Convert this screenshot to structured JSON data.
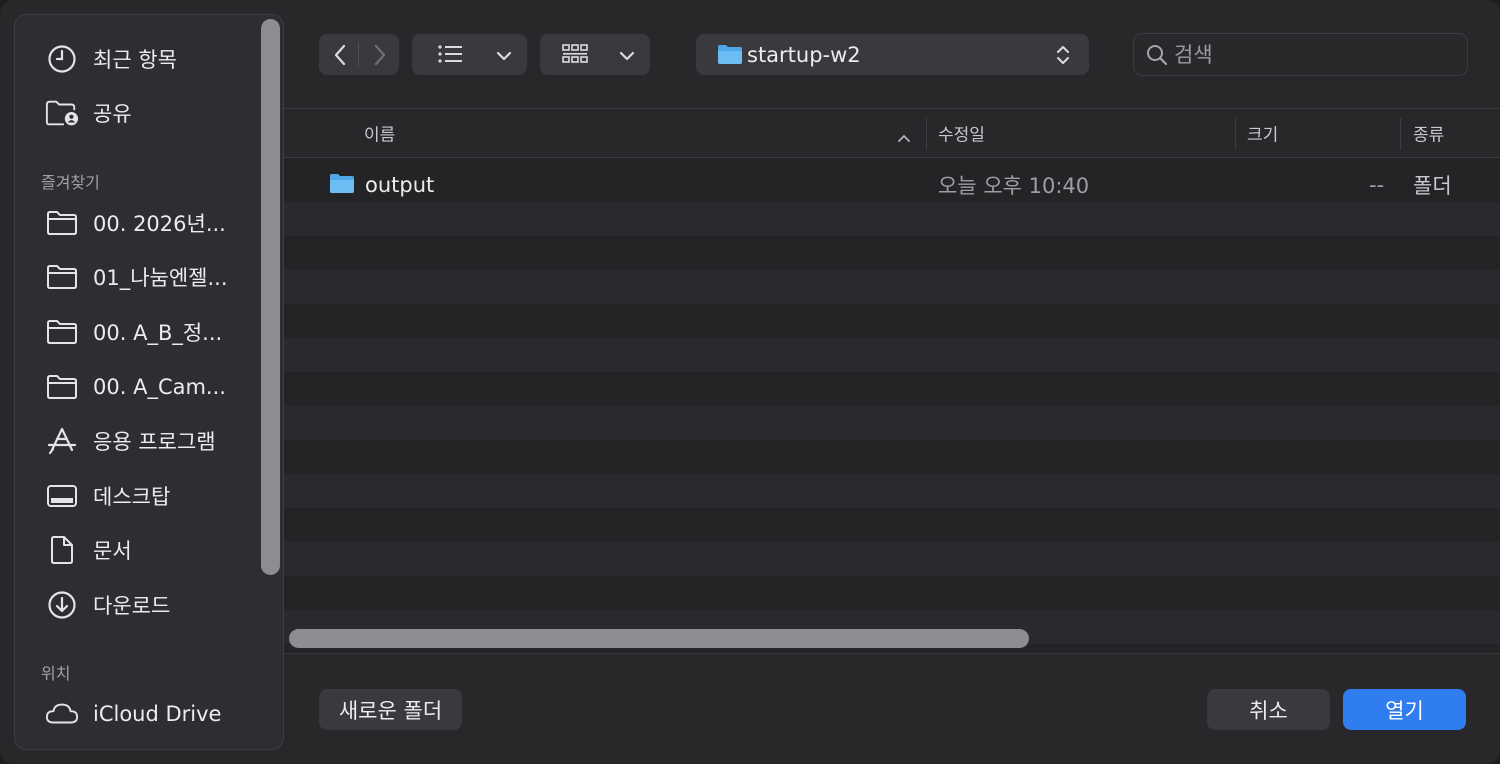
{
  "sidebar": {
    "items_top": [
      {
        "label": "최근 항목",
        "icon": "clock-icon"
      },
      {
        "label": "공유",
        "icon": "shared-folder-icon"
      }
    ],
    "favorites_title": "즐겨찾기",
    "favorites": [
      {
        "label": "00. 2026년...",
        "icon": "folder-icon"
      },
      {
        "label": "01_나눔엔젤...",
        "icon": "folder-icon"
      },
      {
        "label": "00. A_B_정...",
        "icon": "folder-icon"
      },
      {
        "label": "00. A_Cam...",
        "icon": "folder-icon"
      },
      {
        "label": "응용 프로그램",
        "icon": "applications-icon"
      },
      {
        "label": "데스크탑",
        "icon": "desktop-icon"
      },
      {
        "label": "문서",
        "icon": "document-icon"
      },
      {
        "label": "다운로드",
        "icon": "download-icon"
      }
    ],
    "locations_title": "위치",
    "locations": [
      {
        "label": "iCloud Drive",
        "icon": "cloud-icon"
      }
    ]
  },
  "toolbar": {
    "current_folder": "startup-w2",
    "search_placeholder": "검색"
  },
  "columns": {
    "name": "이름",
    "modified": "수정일",
    "size": "크기",
    "kind": "종류"
  },
  "files": [
    {
      "name": "output",
      "modified": "오늘 오후 10:40",
      "size": "--",
      "kind": "폴더"
    }
  ],
  "buttons": {
    "new_folder": "새로운 폴더",
    "cancel": "취소",
    "open": "열기"
  },
  "colors": {
    "accent": "#2f7dee",
    "folder": "#5fb4f0"
  }
}
